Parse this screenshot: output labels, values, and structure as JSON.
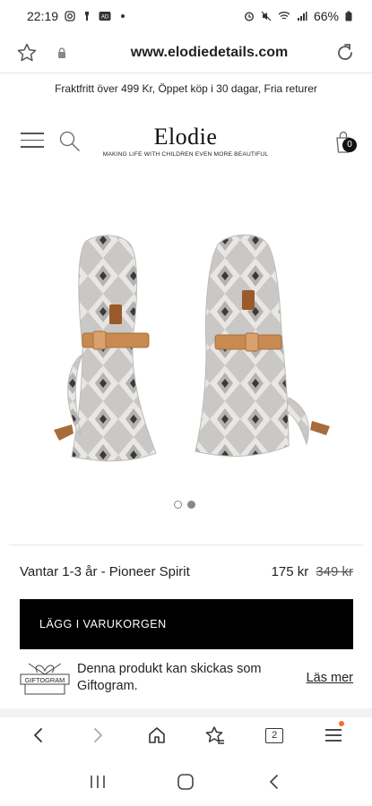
{
  "status_bar": {
    "time": "22:19",
    "battery": "66%",
    "left_icons": [
      "instagram-icon",
      "flashlight-icon",
      "ad-icon",
      "dot-icon"
    ],
    "right_icons": [
      "alarm-icon",
      "mute-icon",
      "wifi-icon",
      "signal-icon",
      "battery-icon"
    ]
  },
  "browser": {
    "url": "www.elodiedetails.com"
  },
  "promo_text": "Fraktfritt över 499 Kr, Öppet köp i 30 dagar, Fria returer",
  "brand": {
    "name": "Elodie",
    "tagline": "MAKING LIFE WITH CHILDREN EVEN MORE BEAUTIFUL"
  },
  "cart": {
    "count": "0"
  },
  "carousel": {
    "count": 2,
    "active_index": 1
  },
  "product": {
    "title": "Vantar 1-3 år - Pioneer Spirit",
    "price": "175 kr",
    "old_price": "349 kr",
    "add_to_cart_label": "LÄGG I VARUKORGEN"
  },
  "giftogram": {
    "logo_text": "GIFTOGRAM",
    "message": "Denna produkt kan skickas som Giftogram.",
    "link_label": "Läs mer"
  },
  "toolbar": {
    "tabs_count": "2"
  },
  "colors": {
    "accent_dot": "#ff6a2a",
    "button_bg": "#000000"
  }
}
